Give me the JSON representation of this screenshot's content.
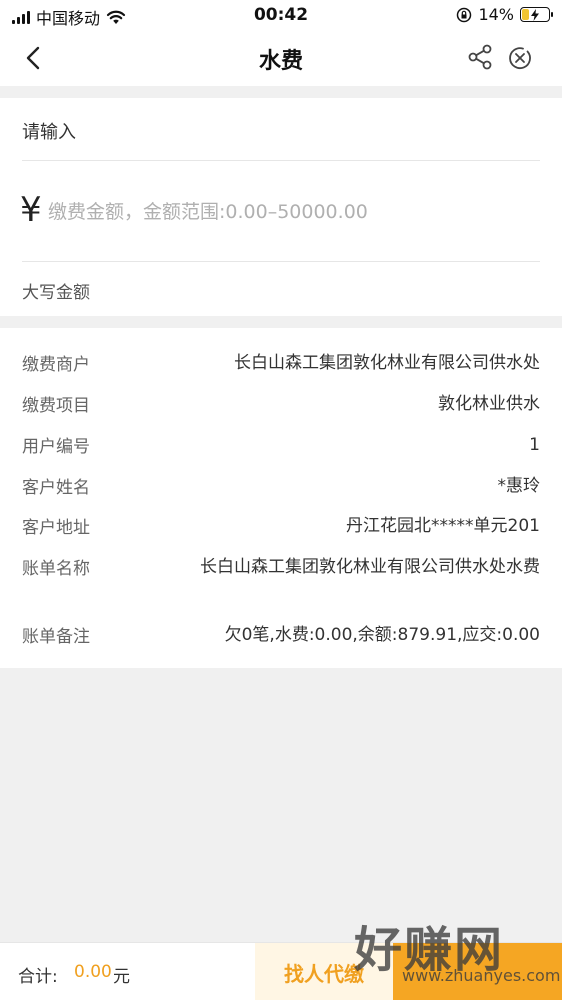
{
  "status_bar": {
    "carrier": "中国移动",
    "time": "00:42",
    "battery_percent": "14%",
    "battery_level": 0.14,
    "icons": [
      "signal-icon",
      "wifi-icon",
      "orientation-lock-icon",
      "battery-charging-icon"
    ]
  },
  "nav": {
    "title": "水费",
    "icons": [
      "back-arrow-icon",
      "share-icon",
      "close-circle-icon"
    ]
  },
  "input_section": {
    "label": "请输入",
    "currency_symbol": "¥",
    "amount_placeholder": "缴费金额，金额范围:0.00–50000.00",
    "capital_label": "大写金额"
  },
  "details": [
    {
      "label": "缴费商户",
      "value": "长白山森工集团敦化林业有限公司供水处"
    },
    {
      "label": "缴费项目",
      "value": "敦化林业供水"
    },
    {
      "label": "用户编号",
      "value": "1"
    },
    {
      "label": "客户姓名",
      "value": "*惠玲"
    },
    {
      "label": "客户地址",
      "value": "丹江花园北*****单元201"
    },
    {
      "label": "账单名称",
      "value": "长白山森工集团敦化林业有限公司供水处水费"
    },
    {
      "label": "账单备注",
      "value": "欠0笔,水费:0.00,余额:879.91,应交:0.00"
    }
  ],
  "bottom_bar": {
    "total_label": "合计:",
    "total_value": "0.00",
    "total_unit": "元",
    "proxy_button_label": "找人代缴",
    "pay_button_label": ""
  },
  "watermark": {
    "text": "好赚网",
    "url": "www.zhuanyes.com"
  },
  "colors": {
    "accent": "#f5a623",
    "accent_text": "#f0a020",
    "background": "#f0f0f0",
    "battery": "#f2c531"
  }
}
